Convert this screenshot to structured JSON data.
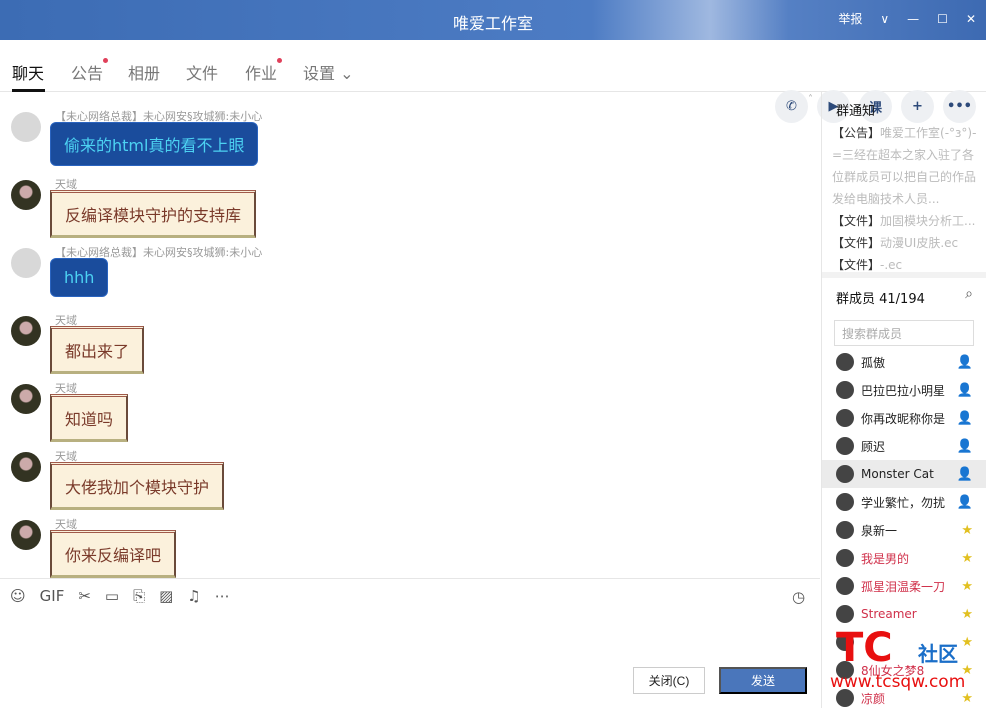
{
  "window": {
    "title": "唯爱工作室",
    "report": "举报",
    "chevron": "∨",
    "minimize": "—",
    "maximize": "☐",
    "close": "✕"
  },
  "tabs": [
    {
      "label": "聊天",
      "active": true,
      "dot": false
    },
    {
      "label": "公告",
      "dot": true
    },
    {
      "label": "相册",
      "dot": false
    },
    {
      "label": "文件",
      "dot": false
    },
    {
      "label": "作业",
      "dot": true
    },
    {
      "label": "设置 ⌄",
      "dot": false
    }
  ],
  "actions": [
    {
      "name": "phone-icon",
      "glyph": "✆"
    },
    {
      "name": "video-icon",
      "glyph": "▶"
    },
    {
      "name": "class-icon",
      "glyph": "课"
    },
    {
      "name": "add-app-icon",
      "glyph": "+"
    },
    {
      "name": "more-icon",
      "glyph": "•••"
    }
  ],
  "messages": [
    {
      "sender": "【未心网络总裁】未心网安§攻城狮:未小心",
      "text": "偷来的html真的看不上眼",
      "style": "blue"
    },
    {
      "sender": "天域",
      "text": "反编译模块守护的支持库",
      "style": "scroll"
    },
    {
      "sender": "【未心网络总裁】未心网安§攻城狮:未小心",
      "text": "hhh",
      "style": "blue"
    },
    {
      "sender": "天域",
      "text": "都出来了",
      "style": "scroll"
    },
    {
      "sender": "天域",
      "text": "知道吗",
      "style": "scroll"
    },
    {
      "sender": "天域",
      "text": "大佬我加个模块守护",
      "style": "scroll"
    },
    {
      "sender": "天域",
      "text": "你来反编译吧",
      "style": "scroll"
    }
  ],
  "toolbar": [
    "☺",
    "GIF",
    "✂",
    "▭",
    "⎘",
    "▨",
    "♫",
    "⋯"
  ],
  "toolbar_names": [
    "emoji-icon",
    "gif-icon",
    "screenshot-icon",
    "folder-icon",
    "doc-icon",
    "image-icon",
    "bell-icon",
    "more-icon"
  ],
  "clock": "◷",
  "buttons": {
    "close": "关闭(C)",
    "send": "发送"
  },
  "notice": {
    "title": "群通知",
    "items": [
      {
        "tag": "【公告】",
        "text": "唯爱工作室(-°з°)-=三经在超本之家入驻了各位群成员可以把自己的作品发给电脑技术人员..."
      },
      {
        "tag": "【文件】",
        "text": "加固模块分析工..."
      },
      {
        "tag": "【文件】",
        "text": "动漫UI皮肤.ec"
      },
      {
        "tag": "【文件】",
        "text": "-.ec"
      }
    ]
  },
  "members": {
    "title": "群成员 41/194",
    "search_placeholder": "搜索群成员",
    "list": [
      {
        "name": "孤傲",
        "badge": "👤",
        "red": false
      },
      {
        "name": "巴拉巴拉小明星",
        "badge": "👤",
        "red": false
      },
      {
        "name": "你再改昵称你是",
        "badge": "👤",
        "red": false
      },
      {
        "name": "顾迟",
        "badge": "👤",
        "red": false
      },
      {
        "name": "Monster Cat",
        "badge": "👤",
        "red": false,
        "selected": true
      },
      {
        "name": "学业繁忙，勿扰",
        "badge": "👤",
        "red": false
      },
      {
        "name": "泉新一",
        "badge": "★",
        "red": false
      },
      {
        "name": "我是男的",
        "badge": "★",
        "red": true
      },
      {
        "name": "孤星泪温柔一刀",
        "badge": "★",
        "red": true
      },
      {
        "name": "Streamer",
        "badge": "★",
        "red": true
      },
      {
        "name": "",
        "badge": "★",
        "red": true
      },
      {
        "name": "8仙女之梦8",
        "badge": "★",
        "red": true
      },
      {
        "name": "凉颜",
        "badge": "★",
        "red": true
      }
    ]
  },
  "watermark": {
    "logo": "TC",
    "cn": "社区",
    "url": "www.tcsqw.com"
  }
}
